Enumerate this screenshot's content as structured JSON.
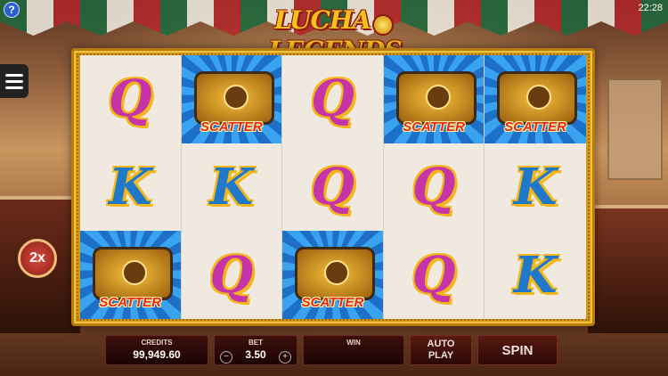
{
  "status": {
    "time": "22:28",
    "help_icon": "?"
  },
  "logo": {
    "left": "LUCHA",
    "right": "LEGENDS"
  },
  "multiplier": "2x",
  "reels": [
    [
      {
        "symbol": "Q"
      },
      {
        "symbol": "K"
      },
      {
        "symbol": "SCATTER"
      }
    ],
    [
      {
        "symbol": "SCATTER"
      },
      {
        "symbol": "K"
      },
      {
        "symbol": "Q"
      }
    ],
    [
      {
        "symbol": "Q"
      },
      {
        "symbol": "Q"
      },
      {
        "symbol": "SCATTER"
      }
    ],
    [
      {
        "symbol": "SCATTER"
      },
      {
        "symbol": "Q"
      },
      {
        "symbol": "Q"
      }
    ],
    [
      {
        "symbol": "SCATTER"
      },
      {
        "symbol": "K"
      },
      {
        "symbol": "K"
      }
    ]
  ],
  "scatter_text": "SCATTER",
  "controls": {
    "credits_label": "CREDITS",
    "credits_value": "99,949.60",
    "bet_label": "BET",
    "bet_value": "3.50",
    "bet_minus": "−",
    "bet_plus": "+",
    "win_label": "WIN",
    "win_value": "",
    "autoplay_line1": "AUTO",
    "autoplay_line2": "PLAY",
    "spin_label": "SPIN"
  },
  "icons": {
    "menu": "hamburger-menu-icon",
    "help": "help-icon"
  },
  "colors": {
    "q_symbol": "#c535a8",
    "k_symbol": "#1f78c8",
    "frame_gold": "#d39a18",
    "scatter_bg": "#1d6fc7"
  }
}
